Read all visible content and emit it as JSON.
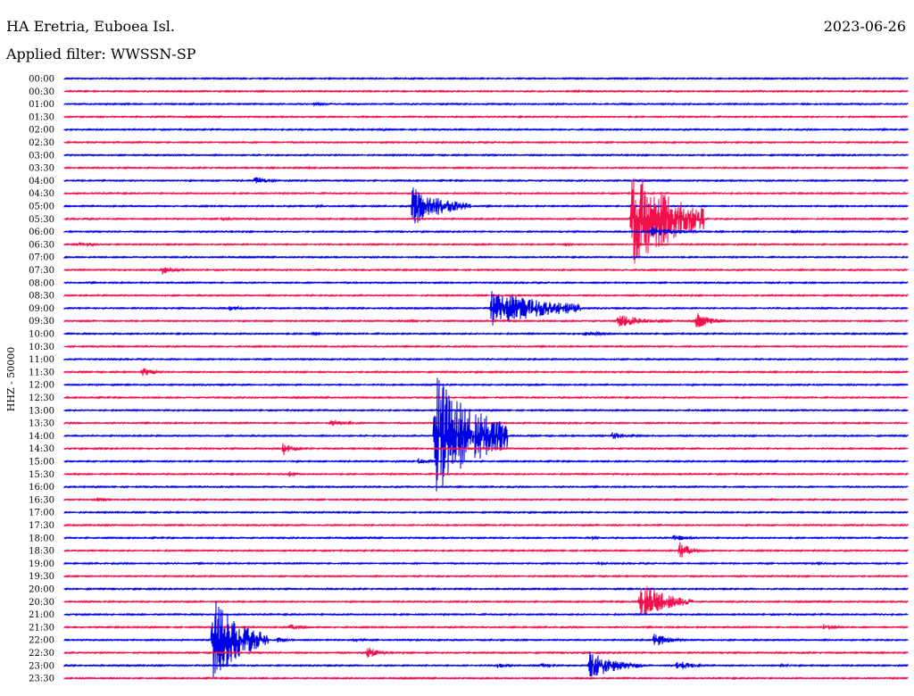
{
  "header": {
    "station": "HA Eretria, Euboea Isl.",
    "date": "2023-06-26",
    "filter_label": "Applied filter: WWSSN-SP"
  },
  "colors": {
    "even": "#0000e6",
    "odd": "#f0104c"
  },
  "chart_data": {
    "type": "line",
    "title": "HA Eretria, Euboea Isl.",
    "ylabel": "HHZ - 50000",
    "row_interval_minutes": 30,
    "x_range_minutes": [
      0,
      30
    ],
    "rows": [
      "00:00",
      "00:30",
      "01:00",
      "01:30",
      "02:00",
      "02:30",
      "03:00",
      "03:30",
      "04:00",
      "04:30",
      "05:00",
      "05:30",
      "06:00",
      "06:30",
      "07:00",
      "07:30",
      "08:00",
      "08:30",
      "09:00",
      "09:30",
      "10:00",
      "10:30",
      "11:00",
      "11:30",
      "12:00",
      "12:30",
      "13:00",
      "13:30",
      "14:00",
      "14:30",
      "15:00",
      "15:30",
      "16:00",
      "16:30",
      "17:00",
      "17:30",
      "18:00",
      "18:30",
      "19:00",
      "19:30",
      "20:00",
      "20:30",
      "21:00",
      "21:30",
      "22:00",
      "22:30",
      "23:00",
      "23:30"
    ],
    "events": [
      {
        "row": 1,
        "minute": 18.2,
        "amplitude": 2,
        "duration": 0.5
      },
      {
        "row": 2,
        "minute": 8.9,
        "amplitude": 3,
        "duration": 0.5
      },
      {
        "row": 4,
        "minute": 11.2,
        "amplitude": 2,
        "duration": 0.5
      },
      {
        "row": 7,
        "minute": 8.7,
        "amplitude": 2,
        "duration": 1.4
      },
      {
        "row": 8,
        "minute": 6.8,
        "amplitude": 9,
        "duration": 0.4
      },
      {
        "row": 10,
        "minute": 12.4,
        "amplitude": 38,
        "duration": 1.1
      },
      {
        "row": 10,
        "minute": 9.0,
        "amplitude": 3,
        "duration": 0.3
      },
      {
        "row": 11,
        "minute": 20.2,
        "amplitude": 100,
        "duration": 1.6
      },
      {
        "row": 11,
        "minute": 5.6,
        "amplitude": 4,
        "duration": 0.5
      },
      {
        "row": 12,
        "minute": 20.9,
        "amplitude": 10,
        "duration": 0.9
      },
      {
        "row": 12,
        "minute": 25.9,
        "amplitude": 4,
        "duration": 0.3
      },
      {
        "row": 13,
        "minute": 0.5,
        "amplitude": 5,
        "duration": 0.6
      },
      {
        "row": 13,
        "minute": 17.8,
        "amplitude": 3,
        "duration": 0.4
      },
      {
        "row": 15,
        "minute": 3.5,
        "amplitude": 10,
        "duration": 0.4
      },
      {
        "row": 18,
        "minute": 15.2,
        "amplitude": 34,
        "duration": 2.2
      },
      {
        "row": 18,
        "minute": 5.9,
        "amplitude": 5,
        "duration": 0.4
      },
      {
        "row": 19,
        "minute": 19.7,
        "amplitude": 13,
        "duration": 0.9
      },
      {
        "row": 19,
        "minute": 22.5,
        "amplitude": 16,
        "duration": 0.5
      },
      {
        "row": 19,
        "minute": 12.2,
        "amplitude": 3,
        "duration": 0.6
      },
      {
        "row": 20,
        "minute": 18.5,
        "amplitude": 5,
        "duration": 0.8
      },
      {
        "row": 20,
        "minute": 8.8,
        "amplitude": 3,
        "duration": 0.5
      },
      {
        "row": 23,
        "minute": 2.8,
        "amplitude": 8,
        "duration": 0.4
      },
      {
        "row": 27,
        "minute": 9.5,
        "amplitude": 7,
        "duration": 0.6
      },
      {
        "row": 28,
        "minute": 13.2,
        "amplitude": 118,
        "duration": 1.6
      },
      {
        "row": 28,
        "minute": 19.5,
        "amplitude": 7,
        "duration": 0.6
      },
      {
        "row": 29,
        "minute": 7.8,
        "amplitude": 13,
        "duration": 0.3
      },
      {
        "row": 30,
        "minute": 12.6,
        "amplitude": 6,
        "duration": 0.4
      },
      {
        "row": 31,
        "minute": 8.0,
        "amplitude": 6,
        "duration": 0.3
      },
      {
        "row": 33,
        "minute": 1.2,
        "amplitude": 4,
        "duration": 0.4
      },
      {
        "row": 36,
        "minute": 18.8,
        "amplitude": 3,
        "duration": 0.3
      },
      {
        "row": 36,
        "minute": 21.7,
        "amplitude": 6,
        "duration": 0.6
      },
      {
        "row": 37,
        "minute": 21.9,
        "amplitude": 16,
        "duration": 0.4
      },
      {
        "row": 38,
        "minute": 19.0,
        "amplitude": 3,
        "duration": 0.4
      },
      {
        "row": 38,
        "minute": 26.8,
        "amplitude": 3,
        "duration": 0.3
      },
      {
        "row": 41,
        "minute": 20.5,
        "amplitude": 40,
        "duration": 0.9
      },
      {
        "row": 43,
        "minute": 8.0,
        "amplitude": 6,
        "duration": 0.5
      },
      {
        "row": 43,
        "minute": 27.0,
        "amplitude": 8,
        "duration": 0.4
      },
      {
        "row": 44,
        "minute": 5.3,
        "amplitude": 80,
        "duration": 1.0
      },
      {
        "row": 44,
        "minute": 6.4,
        "amplitude": 6,
        "duration": 0.4
      },
      {
        "row": 44,
        "minute": 7.6,
        "amplitude": 6,
        "duration": 0.4
      },
      {
        "row": 44,
        "minute": 21.0,
        "amplitude": 14,
        "duration": 0.5
      },
      {
        "row": 44,
        "minute": 10.3,
        "amplitude": 4,
        "duration": 0.4
      },
      {
        "row": 45,
        "minute": 10.8,
        "amplitude": 12,
        "duration": 0.4
      },
      {
        "row": 46,
        "minute": 18.7,
        "amplitude": 28,
        "duration": 0.9
      },
      {
        "row": 46,
        "minute": 21.8,
        "amplitude": 11,
        "duration": 0.5
      },
      {
        "row": 46,
        "minute": 15.4,
        "amplitude": 5,
        "duration": 0.5
      },
      {
        "row": 46,
        "minute": 17.0,
        "amplitude": 5,
        "duration": 0.4
      },
      {
        "row": 46,
        "minute": 25.5,
        "amplitude": 3,
        "duration": 0.5
      }
    ]
  }
}
